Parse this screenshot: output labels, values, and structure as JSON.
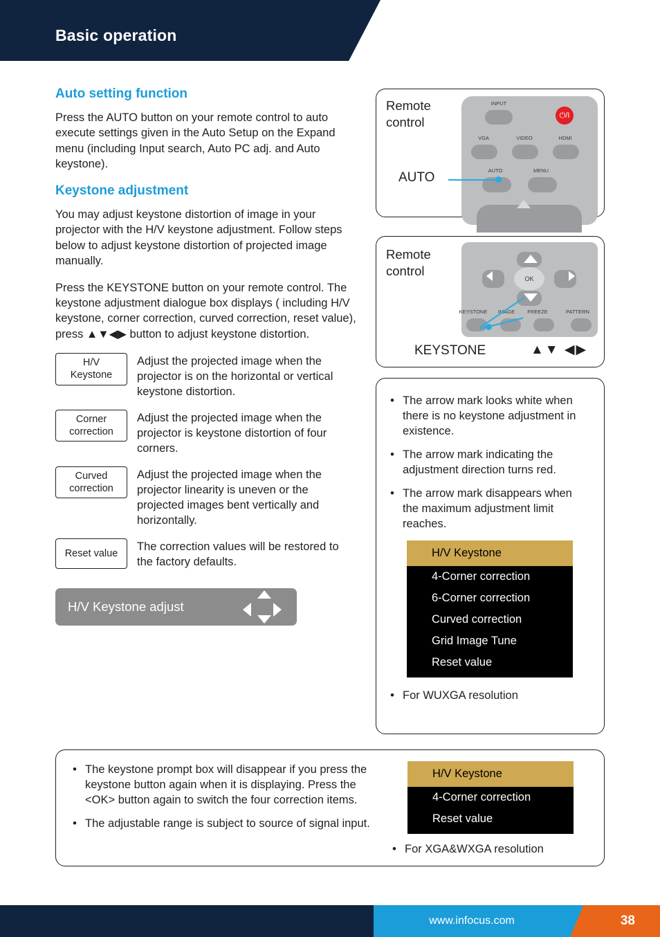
{
  "header": {
    "title": "Basic operation"
  },
  "left": {
    "section1_title": "Auto setting function",
    "section1_body": "Press the AUTO button on your remote control to auto execute settings given in the Auto Setup on the Expand menu (including Input search, Auto PC adj. and Auto keystone).",
    "section2_title": "Keystone adjustment",
    "section2_body1": "You may adjust keystone distortion of image in your projector with the H/V keystone adjustment. Follow steps below to adjust keystone distortion of projected image manually.",
    "section2_body2": "Press the KEYSTONE button on your remote control. The keystone adjustment dialogue box displays ( including H/V keystone, corner correction, curved correction, reset value), press ▲▼◀▶ button to adjust keystone distortion.",
    "definitions": [
      {
        "term_line1": "H/V",
        "term_line2": "Keystone",
        "desc": "Adjust the projected image when the projector is on the horizontal or vertical keystone distortion."
      },
      {
        "term_line1": "Corner",
        "term_line2": "correction",
        "desc": "Adjust the projected image when the projector is keystone distortion of four corners."
      },
      {
        "term_line1": "Curved",
        "term_line2": "correction",
        "desc": "Adjust the projected image when the projector linearity is uneven or the projected images bent vertically and horizontally."
      },
      {
        "term_line1": "Reset value",
        "term_line2": "",
        "desc": "The correction values will be restored to the factory defaults."
      }
    ],
    "hv_bar_label": "H/V Keystone adjust"
  },
  "bottom_note": {
    "bullets": [
      "The keystone prompt box will disappear if you press the keystone button again when it is displaying. Press the <OK> button again to switch the four correction items.",
      "The adjustable range is subject to source of signal input."
    ]
  },
  "remote1": {
    "label_line1": "Remote",
    "label_line2": "control",
    "callout": "AUTO",
    "keys": [
      "INPUT",
      "VGA",
      "VIDEO",
      "HDMI",
      "AUTO",
      "MENU"
    ],
    "power_glyph": "⏻/I"
  },
  "remote2": {
    "label_line1": "Remote",
    "label_line2": "control",
    "callout": "KEYSTONE",
    "arrows": "▲▼ ◀▶",
    "ok_label": "OK",
    "keys": [
      "KEYSTONE",
      "IMAGE",
      "FREEZE",
      "PATTERN"
    ]
  },
  "right_note": {
    "bullets": [
      "The arrow mark looks white when there is no keystone adjustment in existence.",
      "The arrow mark indicating the adjustment direction turns red.",
      "The arrow mark disappears when the maximum adjustment limit reaches."
    ],
    "caption": "For WUXGA resolution"
  },
  "osd_wuxga": {
    "header": "H/V Keystone",
    "items": [
      "4-Corner correction",
      "6-Corner correction",
      "Curved correction",
      "Grid Image Tune",
      "Reset value"
    ]
  },
  "osd_xga": {
    "header": "H/V Keystone",
    "items": [
      "4-Corner correction",
      "Reset value"
    ],
    "caption": "For XGA&WXGA resolution"
  },
  "footer": {
    "url": "www.infocus.com",
    "page": "38"
  },
  "colors": {
    "accent_blue": "#1b9dd9",
    "header_navy": "#10243f",
    "osd_header_gold": "#cfa951",
    "page_orange": "#e8651a",
    "power_red": "#e31e24"
  }
}
